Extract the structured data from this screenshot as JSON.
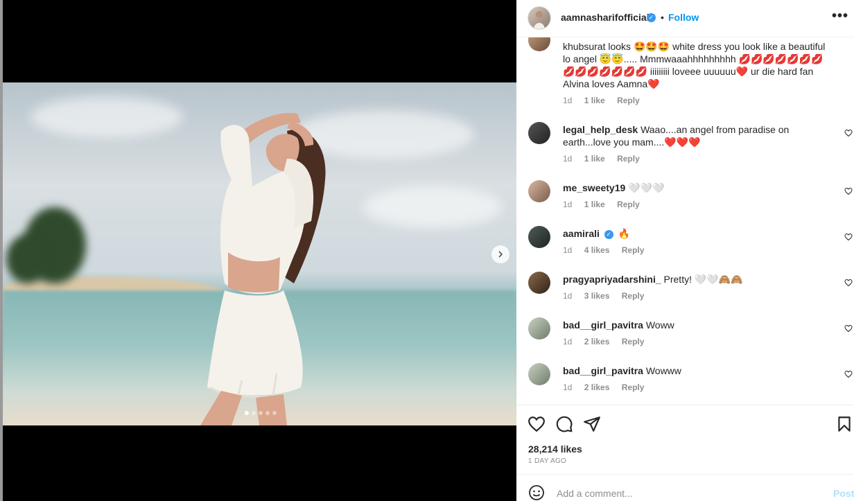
{
  "post": {
    "username": "aamnasharifofficial",
    "separator": "•",
    "follow_label": "Follow",
    "more_label": "•••",
    "carousel": {
      "total_slides": 5,
      "active_slide": 1
    }
  },
  "comments": [
    {
      "username": "",
      "text": "khubsurat looks 🤩🤩🤩 white dress you look like a beautiful lo angel 😇😇..... Mmmwaaahhhhhhhhh 💋💋💋💋💋💋💋💋💋💋💋💋💋💋 iiiiiiiii loveee uuuuuu❤️ ur die hard fan Alvina loves Aamna❤️",
      "time": "1d",
      "likes": "1 like",
      "reply": "Reply"
    },
    {
      "username": "legal_help_desk",
      "text": "Waao....an angel from paradise on earth...love you mam....❤️❤️❤️",
      "time": "1d",
      "likes": "1 like",
      "reply": "Reply"
    },
    {
      "username": "me_sweety19",
      "text": "🤍🤍🤍",
      "time": "1d",
      "likes": "1 like",
      "reply": "Reply"
    },
    {
      "username": "aamirali",
      "text": "🔥",
      "time": "1d",
      "likes": "4 likes",
      "reply": "Reply"
    },
    {
      "username": "pragyapriyadarshini_",
      "text": "Pretty! 🤍🤍🙈🙈",
      "time": "1d",
      "likes": "3 likes",
      "reply": "Reply"
    },
    {
      "username": "bad__girl_pavitra",
      "text": "Woww",
      "time": "1d",
      "likes": "2 likes",
      "reply": "Reply"
    },
    {
      "username": "bad__girl_pavitra",
      "text": "Wowww",
      "time": "1d",
      "likes": "2 likes",
      "reply": "Reply"
    }
  ],
  "footer": {
    "likes_count": "28,214 likes",
    "time_ago": "1 DAY AGO",
    "comment_placeholder": "Add a comment...",
    "post_label": "Post"
  },
  "colors": {
    "link_blue": "#0095f6",
    "verified_blue": "#3897f0",
    "muted_text": "#8e8e8e",
    "heart_red": "#e0245e"
  }
}
